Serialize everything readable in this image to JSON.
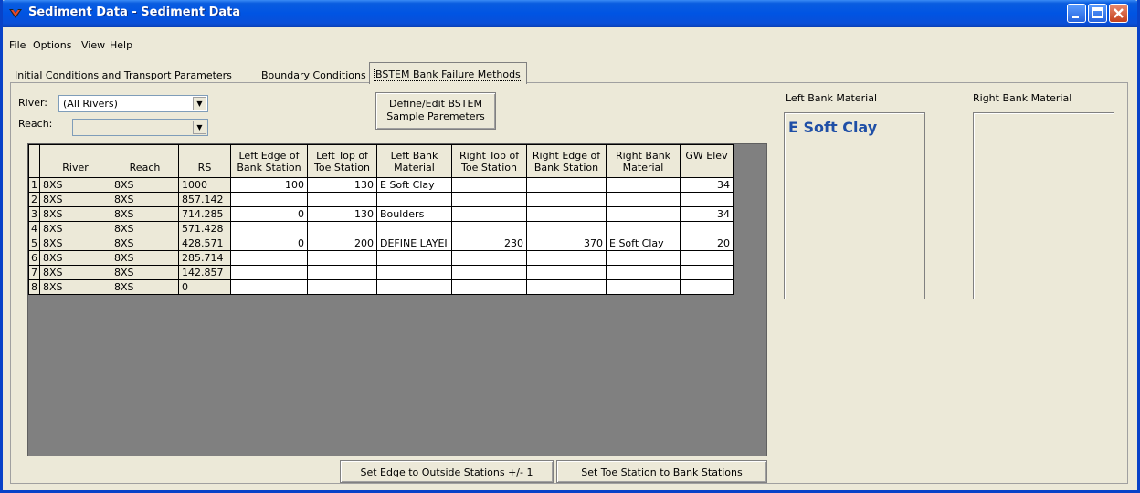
{
  "window": {
    "title": "Sediment Data - Sediment Data",
    "icon": "hec-ras-icon"
  },
  "menu": [
    "File",
    "Options",
    "View",
    "Help"
  ],
  "tabs": [
    "Initial Conditions and Transport Parameters",
    "Boundary Conditions",
    "BSTEM Bank Failure Methods"
  ],
  "active_tab": "BSTEM Bank Failure Methods",
  "filters": {
    "river_label": "River:",
    "river_value": "(All Rivers)",
    "reach_label": "Reach:",
    "reach_value": ""
  },
  "define_button": {
    "line1": "Define/Edit BSTEM",
    "line2": "Sample Paremeters"
  },
  "grid": {
    "header_top": [
      "",
      "",
      "",
      "",
      "Left Edge of",
      "Left Top of",
      "Left Bank",
      "Right Top of",
      "Right Edge of",
      "Right Bank",
      "GW Elev"
    ],
    "header_bottom": [
      "",
      "River",
      "Reach",
      "RS",
      "Bank Station",
      "Toe Station",
      "Material",
      "Toe Station",
      "Bank Station",
      "Material",
      ""
    ],
    "rows": [
      [
        "1",
        "8XS",
        "8XS",
        "1000",
        "100",
        "130",
        "E Soft Clay",
        "",
        "",
        "",
        "34"
      ],
      [
        "2",
        "8XS",
        "8XS",
        "857.142",
        "",
        "",
        "",
        "",
        "",
        "",
        ""
      ],
      [
        "3",
        "8XS",
        "8XS",
        "714.285",
        "0",
        "130",
        "Boulders",
        "",
        "",
        "",
        "34"
      ],
      [
        "4",
        "8XS",
        "8XS",
        "571.428",
        "",
        "",
        "",
        "",
        "",
        "",
        ""
      ],
      [
        "5",
        "8XS",
        "8XS",
        "428.571",
        "0",
        "200",
        "DEFINE LAYEI",
        "230",
        "370",
        "E Soft Clay",
        "20"
      ],
      [
        "6",
        "8XS",
        "8XS",
        "285.714",
        "",
        "",
        "",
        "",
        "",
        "",
        ""
      ],
      [
        "7",
        "8XS",
        "8XS",
        "142.857",
        "",
        "",
        "",
        "",
        "",
        "",
        ""
      ],
      [
        "8",
        "8XS",
        "8XS",
        "0",
        "",
        "",
        "",
        "",
        "",
        "",
        ""
      ]
    ]
  },
  "buttons": {
    "set_edge": "Set Edge to Outside Stations +/- 1",
    "set_toe": "Set Toe Station to Bank Stations"
  },
  "left_bank": {
    "label": "Left Bank Material",
    "value": "E Soft Clay"
  },
  "right_bank": {
    "label": "Right Bank Material",
    "value": ""
  },
  "colors": {
    "title_bar": "#0054e3",
    "window_bg": "#ece9d8",
    "grid_bg": "#808080",
    "material_text": "#1f4fa6"
  }
}
